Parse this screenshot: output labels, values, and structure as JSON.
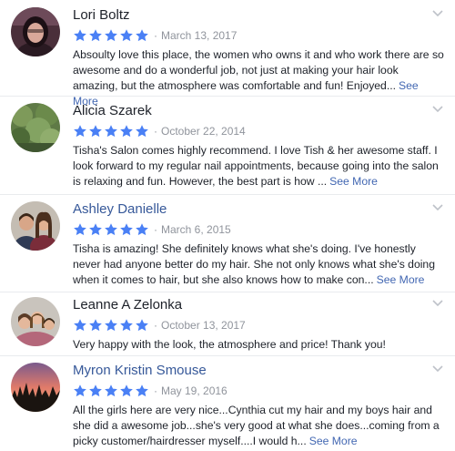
{
  "colors": {
    "star": "#4a80f5",
    "link": "#4267b2",
    "muted": "#90949c"
  },
  "reviews": [
    {
      "name": "Lori Boltz",
      "name_is_link": false,
      "rating": 5,
      "date": "March 13, 2017",
      "text": "Absoulty love this place, the women who owns it and who work there are so awesome and do a wonderful job, not just at making your hair look amazing, but the atmosphere was comfortable and fun! Enjoyed...",
      "see_more": "See More",
      "avatar_icon": "profile-photo-icon"
    },
    {
      "name": "Alicia Szarek",
      "name_is_link": false,
      "rating": 5,
      "date": "October 22, 2014",
      "text": "Tisha's Salon comes highly recommend. I love Tish & her awesome staff. I look forward to my regular nail appointments, because going into the salon is relaxing and fun. However, the best part is how ...",
      "see_more": "See More",
      "avatar_icon": "profile-photo-icon"
    },
    {
      "name": "Ashley Danielle",
      "name_is_link": true,
      "rating": 5,
      "date": "March 6, 2015",
      "text": "Tisha is amazing! She definitely knows what she's doing. I've honestly never had anyone better do my hair. She not only knows what she's doing when it comes to hair, but she also knows how to make con...",
      "see_more": "See More",
      "avatar_icon": "profile-photo-icon"
    },
    {
      "name": "Leanne A Zelonka",
      "name_is_link": false,
      "rating": 5,
      "date": "October 13, 2017",
      "text": "Very happy with the look, the atmosphere and price! Thank you!",
      "see_more": "",
      "avatar_icon": "profile-photo-icon"
    },
    {
      "name": "Myron Kristin Smouse",
      "name_is_link": true,
      "rating": 5,
      "date": "May 19, 2016",
      "text": "All the girls here are very nice...Cynthia cut my hair and my boys hair and she did a awesome job...she's very good at what she does...coming from a picky customer/hairdresser myself....I would h...",
      "see_more": "See More",
      "avatar_icon": "profile-photo-icon"
    }
  ]
}
